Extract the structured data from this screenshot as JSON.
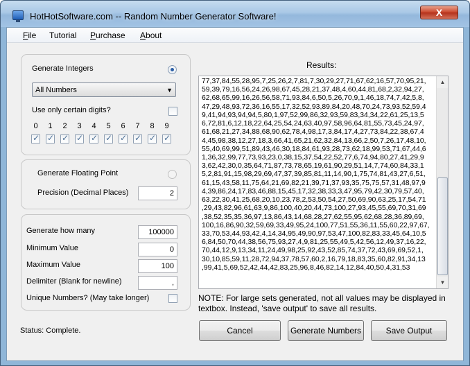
{
  "window": {
    "title": "HotHotSoftware.com -- Random Number Generator Software!",
    "close_label": "X"
  },
  "menu": {
    "file": {
      "u": "F",
      "rest": "ile"
    },
    "tutorial": "Tutorial",
    "purchase": {
      "u": "P",
      "rest": "urchase"
    },
    "about": {
      "u": "A",
      "rest": "bout"
    }
  },
  "integers_group": {
    "label": "Generate Integers",
    "selected": true,
    "mode_value": "All Numbers",
    "only_digits_label": "Use only certain digits?",
    "only_digits_checked": false,
    "digits": [
      "0",
      "1",
      "2",
      "3",
      "4",
      "5",
      "6",
      "7",
      "8",
      "9"
    ],
    "digits_checked": [
      true,
      true,
      true,
      true,
      true,
      true,
      true,
      true,
      true,
      true
    ]
  },
  "float_group": {
    "label": "Generate Floating Point",
    "selected": false,
    "precision_label": "Precision (Decimal Places)",
    "precision_value": "2"
  },
  "options_group": {
    "how_many_label": "Generate how many",
    "how_many_value": "100000",
    "min_label": "Minimum Value",
    "min_value": "0",
    "max_label": "Maximum Value",
    "max_value": "100",
    "delimiter_label": "Delimiter (Blank for newline)",
    "delimiter_value": ",",
    "unique_label": "Unique Numbers? (May take longer)",
    "unique_checked": false
  },
  "status": "Status: Complete.",
  "results": {
    "title": "Results:",
    "lines": [
      "77,37,84,55,28,95,7,25,26,2,7,81,7,30,29,27,71,67,62,16,57,70,95,21,",
      "59,39,79,16,56,24,26,98,67,45,28,21,37,48,4,60,44,81,68,2,32,94,27,",
      "62,68,65,99,16,26,56,58,71,93,84,6,50,5,26,70,9,1,46,18,74,7,42,5,8,",
      "47,29,48,93,72,36,16,55,17,32,52,93,89,84,20,48,70,24,73,93,52,59,4",
      "9,41,94,93,94,94,5,80,1,97,52,99,86,32,93,59,83,34,34,22,61,25,13,5",
      "6,72,81,6,12,18,22,64,25,54,24,63,40,97,58,96,64,81,55,73,45,24,97,",
      "61,68,21,27,34,88,68,90,62,78,4,98,17,3,84,17,4,27,73,84,22,38,67,4",
      "4,45,98,38,12,27,18,3,66,41,65,21,62,32,84,13,66,2,50,7,26,17,48,10,",
      "55,40,69,99,51,89,43,46,30,18,84,61,93,28,73,62,18,99,53,71,67,44,6",
      "1,36,32,99,77,73,93,23,0,38,15,37,54,22,52,77,6,74,94,80,27,41,29,9",
      "3,62,42,30,0,35,64,71,87,73,78,65,19,61,90,29,51,14,7,74,60,84,33,1",
      "5,2,81,91,15,98,29,69,47,37,39,85,81,11,14,90,1,75,74,81,43,27,6,51,",
      "61,15,43,58,11,75,64,21,69,82,21,39,71,37,93,35,75,75,57,31,48,97,9",
      "4,39,86,24,17,83,46,88,15,45,17,32,38,33,3,47,95,79,42,30,79,57,40,",
      "63,22,30,41,25,68,20,10,23,78,2,53,50,54,27,50,69,90,63,25,17,54,71",
      ",29,43,82,96,61,63,9,86,100,40,20,44,73,100,27,93,45,55,69,70,31,69",
      ",38,52,35,35,36,97,13,86,43,14,68,28,27,62,55,95,62,68,28,36,89,69,",
      "100,16,86,90,32,59,69,33,49,95,24,100,77,51,55,36,11,55,60,22,97,67,",
      "33,70,53,44,93,42,4,14,34,95,49,90,97,53,47,100,82,83,33,45,64,10,5",
      "6,84,50,70,44,38,56,75,93,27,4,9,81,25,55,49,5,42,56,12,49,37,16,22,",
      "70,44,12,9,13,34,11,24,49,98,25,92,43,52,85,74,37,72,43,69,69,52,1,",
      "30,10,85,59,11,28,72,94,37,78,57,60,2,16,79,18,83,35,60,82,91,34,13",
      ",99,41,5,69,52,42,44,42,83,25,96,8,46,82,14,12,84,40,50,4,31,53"
    ]
  },
  "note": "NOTE: For large sets generated, not all values may be displayed in textbox. Instead, 'save output' to save all results.",
  "buttons": {
    "cancel": "Cancel",
    "generate": "Generate Numbers",
    "save": "Save Output"
  },
  "scrollbar": {
    "up_icon": "▲",
    "down_icon": "▼"
  }
}
